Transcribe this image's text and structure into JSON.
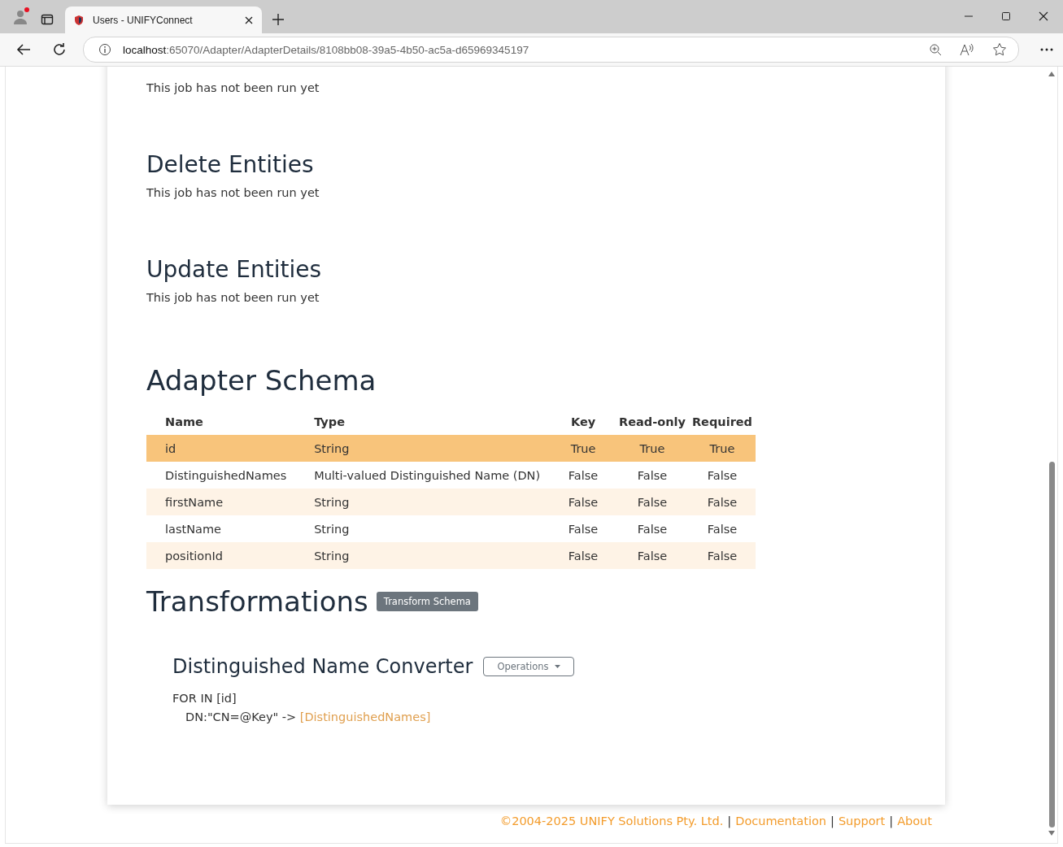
{
  "browser": {
    "tab_title": "Users - UNIFYConnect",
    "url_host": "localhost",
    "url_path": ":65070/Adapter/AdapterDetails/8108bb08-39a5-4b50-ac5a-d65969345197"
  },
  "jobs": [
    {
      "status": "This job has not been run yet"
    },
    {
      "title": "Delete Entities",
      "status": "This job has not been run yet"
    },
    {
      "title": "Update Entities",
      "status": "This job has not been run yet"
    }
  ],
  "schema": {
    "title": "Adapter Schema",
    "columns": [
      "Name",
      "Type",
      "Key",
      "Read-only",
      "Required"
    ],
    "rows": [
      {
        "selected": true,
        "cells": [
          "id",
          "String",
          "True",
          "True",
          "True"
        ]
      },
      {
        "selected": false,
        "cells": [
          "DistinguishedNames",
          "Multi-valued Distinguished Name (DN)",
          "False",
          "False",
          "False"
        ]
      },
      {
        "selected": false,
        "cells": [
          "firstName",
          "String",
          "False",
          "False",
          "False"
        ]
      },
      {
        "selected": false,
        "cells": [
          "lastName",
          "String",
          "False",
          "False",
          "False"
        ]
      },
      {
        "selected": false,
        "cells": [
          "positionId",
          "String",
          "False",
          "False",
          "False"
        ]
      }
    ]
  },
  "transformations": {
    "title": "Transformations",
    "button": "Transform Schema",
    "items": [
      {
        "title": "Distinguished Name Converter",
        "menu": "Operations",
        "line_1": "FOR IN [id]",
        "line_2_prefix": "DN:\"CN=@Key\" ->",
        "line_2_target": "[DistinguishedNames]"
      }
    ]
  },
  "footer": {
    "copyright": "©2004-2025 UNIFY Solutions Pty. Ltd.",
    "separator": "|",
    "links": [
      "Documentation",
      "Support",
      "About"
    ]
  }
}
